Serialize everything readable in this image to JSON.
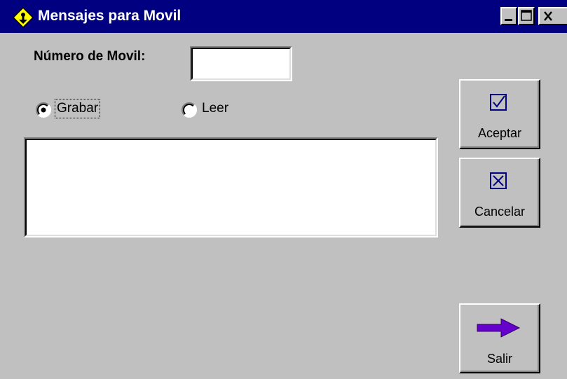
{
  "window": {
    "title": "Mensajes para Movil",
    "controls": [
      "minimize-icon",
      "maximize-icon",
      "close-icon"
    ],
    "icon": "app-diamond-icon"
  },
  "form": {
    "movil_label": "Número de Movil:",
    "movil_value": "",
    "mode_options": [
      {
        "label": "Grabar",
        "selected": true
      },
      {
        "label": "Leer",
        "selected": false
      }
    ],
    "message_value": ""
  },
  "buttons": {
    "aceptar": {
      "label": "Aceptar",
      "icon": "checkbox-checked-icon"
    },
    "cancelar": {
      "label": "Cancelar",
      "icon": "checkbox-x-icon"
    },
    "salir": {
      "label": "Salir",
      "icon": "arrow-right-icon"
    }
  },
  "colors": {
    "titlebar": "#000080",
    "face": "#c0c0c0",
    "arrow": "#6600cc",
    "icon_yellow": "#ffff00"
  }
}
